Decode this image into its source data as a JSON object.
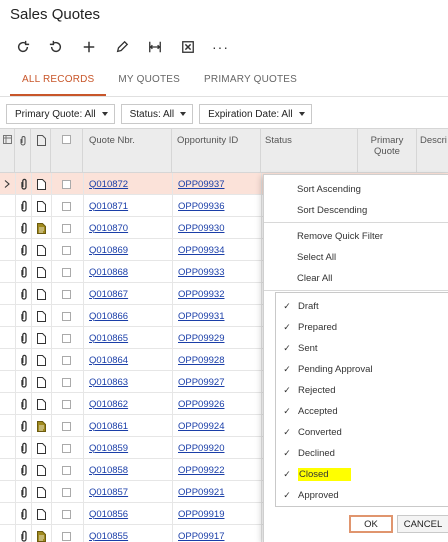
{
  "page": {
    "title": "Sales Quotes"
  },
  "toolbar": {
    "buttons": [
      {
        "name": "refresh-icon"
      },
      {
        "name": "undo-icon"
      },
      {
        "name": "add-icon"
      },
      {
        "name": "edit-icon"
      },
      {
        "name": "fit-columns-icon"
      },
      {
        "name": "export-excel-icon"
      },
      {
        "name": "more-icon",
        "label": "···"
      }
    ]
  },
  "tabs": [
    {
      "label": "ALL RECORDS",
      "active": true
    },
    {
      "label": "MY QUOTES",
      "active": false
    },
    {
      "label": "PRIMARY QUOTES",
      "active": false
    }
  ],
  "filters": [
    {
      "label": "Primary Quote: All"
    },
    {
      "label": "Status: All"
    },
    {
      "label": "Expiration Date: All"
    }
  ],
  "grid": {
    "headers": {
      "quote_nbr": "Quote Nbr.",
      "opportunity_id": "Opportunity ID",
      "status": "Status",
      "primary_quote": "Primary\nQuote",
      "description": "Descri"
    },
    "rows": [
      {
        "quote": "Q010872",
        "opp": "OPP09937",
        "doc": "plain",
        "selected": true
      },
      {
        "quote": "Q010871",
        "opp": "OPP09936",
        "doc": "plain"
      },
      {
        "quote": "Q010870",
        "opp": "OPP09930",
        "doc": "filled"
      },
      {
        "quote": "Q010869",
        "opp": "OPP09934",
        "doc": "plain"
      },
      {
        "quote": "Q010868",
        "opp": "OPP09933",
        "doc": "plain"
      },
      {
        "quote": "Q010867",
        "opp": "OPP09932",
        "doc": "plain"
      },
      {
        "quote": "Q010866",
        "opp": "OPP09931",
        "doc": "plain"
      },
      {
        "quote": "Q010865",
        "opp": "OPP09929",
        "doc": "plain"
      },
      {
        "quote": "Q010864",
        "opp": "OPP09928",
        "doc": "plain"
      },
      {
        "quote": "Q010863",
        "opp": "OPP09927",
        "doc": "plain"
      },
      {
        "quote": "Q010862",
        "opp": "OPP09926",
        "doc": "plain"
      },
      {
        "quote": "Q010861",
        "opp": "OPP09924",
        "doc": "filled"
      },
      {
        "quote": "Q010859",
        "opp": "OPP09920",
        "doc": "plain"
      },
      {
        "quote": "Q010858",
        "opp": "OPP09922",
        "doc": "plain"
      },
      {
        "quote": "Q010857",
        "opp": "OPP09921",
        "doc": "plain"
      },
      {
        "quote": "Q010856",
        "opp": "OPP09919",
        "doc": "plain"
      },
      {
        "quote": "Q010855",
        "opp": "OPP09917",
        "doc": "filled"
      }
    ]
  },
  "popup": {
    "menu": {
      "sort_ascending": "Sort Ascending",
      "sort_descending": "Sort Descending",
      "remove_quick_filter": "Remove Quick Filter",
      "select_all": "Select All",
      "clear_all": "Clear All"
    },
    "values": [
      {
        "label": "Draft",
        "checked": true
      },
      {
        "label": "Prepared",
        "checked": true
      },
      {
        "label": "Sent",
        "checked": true
      },
      {
        "label": "Pending Approval",
        "checked": true
      },
      {
        "label": "Rejected",
        "checked": true
      },
      {
        "label": "Accepted",
        "checked": true
      },
      {
        "label": "Converted",
        "checked": true
      },
      {
        "label": "Declined",
        "checked": true
      },
      {
        "label": "Closed",
        "checked": true,
        "highlighted": true
      },
      {
        "label": "Approved",
        "checked": true
      }
    ],
    "ok_label": "OK",
    "cancel_label": "CANCEL",
    "check_glyph": "✓"
  },
  "colors": {
    "accent": "#c8562a",
    "link": "#1a3ea8",
    "selected_row": "#fbe2d9",
    "highlight": "#ffff00",
    "clip_fill": "#a08a1e"
  }
}
